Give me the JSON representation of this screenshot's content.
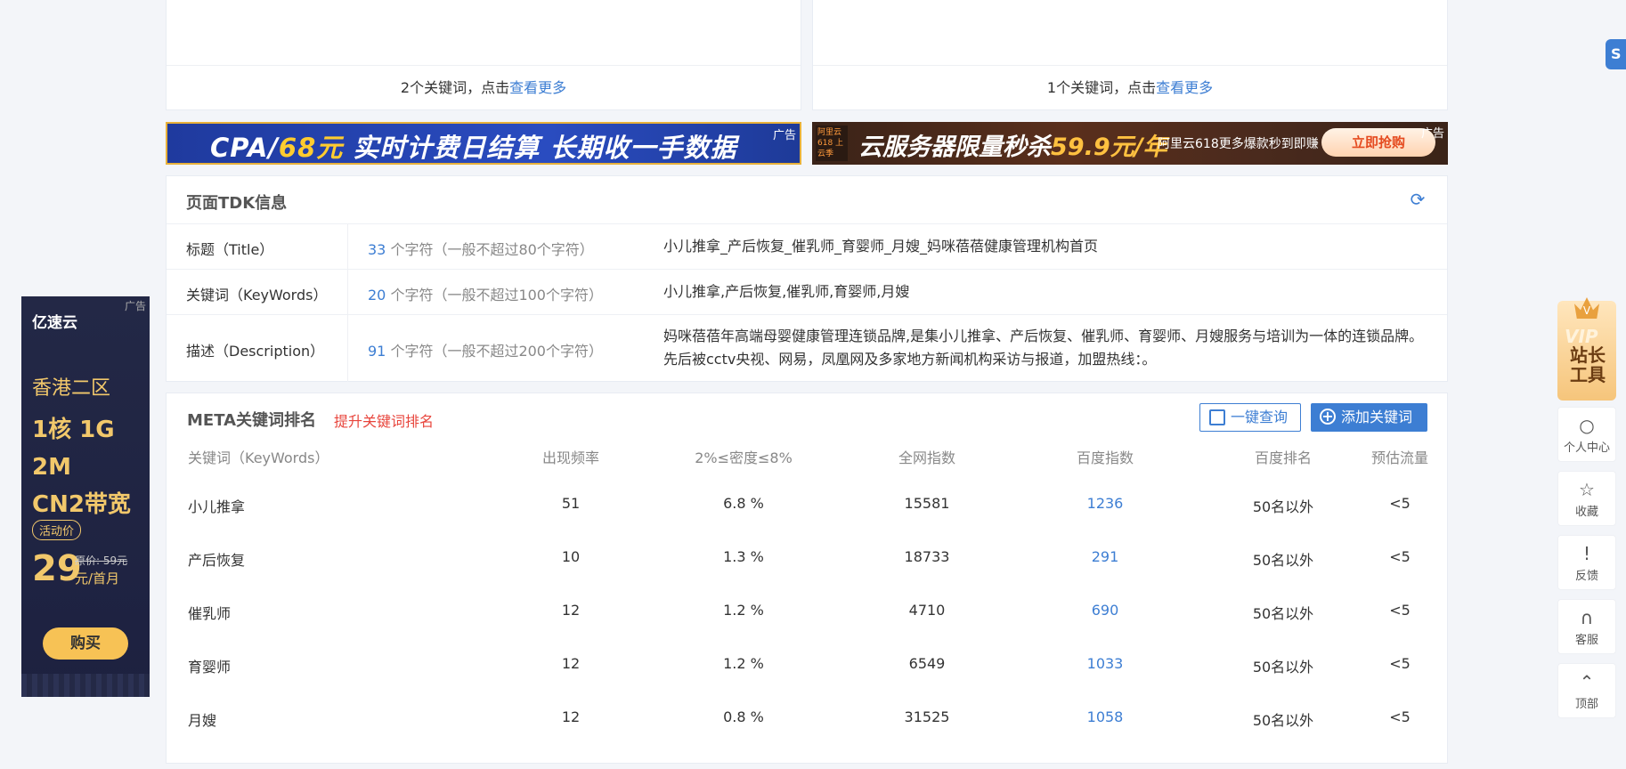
{
  "top_cards": [
    {
      "prefix": "2个关键词，点击",
      "link": "查看更多"
    },
    {
      "prefix": "1个关键词，点击",
      "link": "查看更多"
    }
  ],
  "banner_ads": {
    "ad1": {
      "text_a": "CPA/",
      "text_b": "68元",
      "text_c": "  实时计费日结算  长期收一手数据",
      "tag": "广告"
    },
    "ad2": {
      "logo": "阿里云 618 上云季",
      "main_a": "云服务器限量秒杀",
      "main_b": "59.9元/年",
      "sub": "阿里云618更多爆款秒到即赚",
      "button": "立即抢购",
      "tag": "广告"
    }
  },
  "tdk": {
    "title": "页面TDK信息",
    "rows": [
      {
        "label": "标题（Title）",
        "count": "33",
        "count_suffix": " 个字符（一般不超过80个字符）",
        "value": "小儿推拿_产后恢复_催乳师_育婴师_月嫂_妈咪蓓蓓健康管理机构首页"
      },
      {
        "label": "关键词（KeyWords）",
        "count": "20",
        "count_suffix": " 个字符（一般不超过100个字符）",
        "value": "小儿推拿,产后恢复,催乳师,育婴师,月嫂"
      },
      {
        "label": "描述（Description）",
        "count": "91",
        "count_suffix": " 个字符（一般不超过200个字符）",
        "value": "妈咪蓓蓓年高端母婴健康管理连锁品牌,是集小儿推拿、产后恢复、催乳师、育婴师、月嫂服务与培训为一体的连锁品牌。先后被cctv央视、网易，凤凰网及多家地方新闻机构采访与报道，加盟热线：。"
      }
    ]
  },
  "meta": {
    "title": "META关键词排名",
    "subtitle": "提升关键词排名",
    "query_button": "一键查询",
    "add_button": "添加关键词",
    "columns": [
      "关键词（KeyWords）",
      "出现频率",
      "2%≤密度≤8%",
      "全网指数",
      "百度指数",
      "百度排名",
      "预估流量"
    ],
    "rows": [
      [
        "小儿推拿",
        "51",
        "6.8 %",
        "15581",
        "1236",
        "50名以外",
        "<5"
      ],
      [
        "产后恢复",
        "10",
        "1.3 %",
        "18733",
        "291",
        "50名以外",
        "<5"
      ],
      [
        "催乳师",
        "12",
        "1.2 %",
        "4710",
        "690",
        "50名以外",
        "<5"
      ],
      [
        "育婴师",
        "12",
        "1.2 %",
        "6549",
        "1033",
        "50名以外",
        "<5"
      ],
      [
        "月嫂",
        "12",
        "0.8 %",
        "31525",
        "1058",
        "50名以外",
        "<5"
      ]
    ]
  },
  "left_ad": {
    "tag": "广告",
    "brand": "亿速云",
    "line1": "香港二区",
    "line2": "1核 1G 2M",
    "line3": "CN2带宽",
    "pill": "活动价",
    "price": "29",
    "orig": "原价: 59元",
    "unit": "元/首月",
    "buy": "购买"
  },
  "sidebar": {
    "vip_badge": "V",
    "vip_v": "VIP",
    "vip_text": "站长工具",
    "items": [
      "个人中心",
      "收藏",
      "反馈",
      "客服",
      "顶部"
    ]
  },
  "corner_badge": "S"
}
